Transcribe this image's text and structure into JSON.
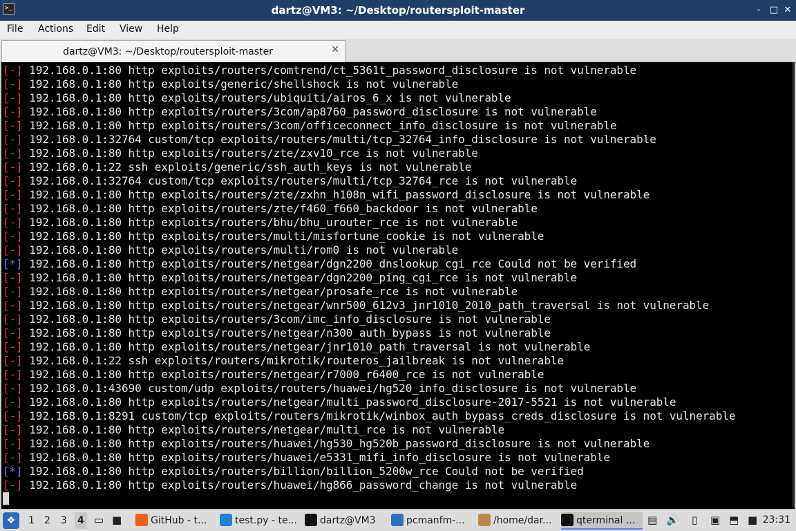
{
  "window": {
    "title": "dartz@VM3: ~/Desktop/routersploit-master",
    "app_icon": "terminal-icon",
    "controls": [
      "-",
      "□",
      "✕"
    ]
  },
  "menu": [
    "File",
    "Actions",
    "Edit",
    "View",
    "Help"
  ],
  "tab": {
    "label": "dartz@VM3: ~/Desktop/routersploit-master",
    "close": "✕"
  },
  "terminal": {
    "lines": [
      {
        "mark": "[-]",
        "text": " 192.168.0.1:80 http exploits/routers/comtrend/ct_5361t_password_disclosure is not vulnerable"
      },
      {
        "mark": "[-]",
        "text": " 192.168.0.1:80 http exploits/generic/shellshock is not vulnerable"
      },
      {
        "mark": "[-]",
        "text": " 192.168.0.1:80 http exploits/routers/ubiquiti/airos_6_x is not vulnerable"
      },
      {
        "mark": "[-]",
        "text": " 192.168.0.1:80 http exploits/routers/3com/ap8760_password_disclosure is not vulnerable"
      },
      {
        "mark": "[-]",
        "text": " 192.168.0.1:80 http exploits/routers/3com/officeconnect_info_disclosure is not vulnerable"
      },
      {
        "mark": "[-]",
        "text": " 192.168.0.1:32764 custom/tcp exploits/routers/multi/tcp_32764_info_disclosure is not vulnerable"
      },
      {
        "mark": "[-]",
        "text": " 192.168.0.1:80 http exploits/routers/zte/zxv10_rce is not vulnerable"
      },
      {
        "mark": "[-]",
        "text": " 192.168.0.1:22 ssh exploits/generic/ssh_auth_keys is not vulnerable"
      },
      {
        "mark": "[-]",
        "text": " 192.168.0.1:32764 custom/tcp exploits/routers/multi/tcp_32764_rce is not vulnerable"
      },
      {
        "mark": "[-]",
        "text": " 192.168.0.1:80 http exploits/routers/zte/zxhn_h108n_wifi_password_disclosure is not vulnerable"
      },
      {
        "mark": "[-]",
        "text": " 192.168.0.1:80 http exploits/routers/zte/f460_f660_backdoor is not vulnerable"
      },
      {
        "mark": "[-]",
        "text": " 192.168.0.1:80 http exploits/routers/bhu/bhu_urouter_rce is not vulnerable"
      },
      {
        "mark": "[-]",
        "text": " 192.168.0.1:80 http exploits/routers/multi/misfortune_cookie is not vulnerable"
      },
      {
        "mark": "[-]",
        "text": " 192.168.0.1:80 http exploits/routers/multi/rom0 is not vulnerable"
      },
      {
        "mark": "[*]",
        "text": " 192.168.0.1:80 http exploits/routers/netgear/dgn2200_dnslookup_cgi_rce Could not be verified"
      },
      {
        "mark": "[-]",
        "text": " 192.168.0.1:80 http exploits/routers/netgear/dgn2200_ping_cgi_rce is not vulnerable"
      },
      {
        "mark": "[-]",
        "text": " 192.168.0.1:80 http exploits/routers/netgear/prosafe_rce is not vulnerable"
      },
      {
        "mark": "[-]",
        "text": " 192.168.0.1:80 http exploits/routers/netgear/wnr500_612v3_jnr1010_2010_path_traversal is not vulnerable"
      },
      {
        "mark": "[-]",
        "text": " 192.168.0.1:80 http exploits/routers/3com/imc_info_disclosure is not vulnerable"
      },
      {
        "mark": "[-]",
        "text": " 192.168.0.1:80 http exploits/routers/netgear/n300_auth_bypass is not vulnerable"
      },
      {
        "mark": "[-]",
        "text": " 192.168.0.1:80 http exploits/routers/netgear/jnr1010_path_traversal is not vulnerable"
      },
      {
        "mark": "[-]",
        "text": " 192.168.0.1:22 ssh exploits/routers/mikrotik/routeros_jailbreak is not vulnerable"
      },
      {
        "mark": "[-]",
        "text": " 192.168.0.1:80 http exploits/routers/netgear/r7000_r6400_rce is not vulnerable"
      },
      {
        "mark": "[-]",
        "text": " 192.168.0.1:43690 custom/udp exploits/routers/huawei/hg520_info_disclosure is not vulnerable"
      },
      {
        "mark": "[-]",
        "text": " 192.168.0.1:80 http exploits/routers/netgear/multi_password_disclosure-2017-5521 is not vulnerable"
      },
      {
        "mark": "[-]",
        "text": " 192.168.0.1:8291 custom/tcp exploits/routers/mikrotik/winbox_auth_bypass_creds_disclosure is not vulnerable"
      },
      {
        "mark": "[-]",
        "text": " 192.168.0.1:80 http exploits/routers/netgear/multi_rce is not vulnerable"
      },
      {
        "mark": "[-]",
        "text": " 192.168.0.1:80 http exploits/routers/huawei/hg530_hg520b_password_disclosure is not vulnerable"
      },
      {
        "mark": "[-]",
        "text": " 192.168.0.1:80 http exploits/routers/huawei/e5331_mifi_info_disclosure is not vulnerable"
      },
      {
        "mark": "[*]",
        "text": " 192.168.0.1:80 http exploits/routers/billion/billion_5200w_rce Could not be verified"
      },
      {
        "mark": "[-]",
        "text": " 192.168.0.1:80 http exploits/routers/huawei/hg866_password_change is not vulnerable"
      }
    ]
  },
  "taskbar": {
    "workspaces": [
      "1",
      "2",
      "3",
      "4"
    ],
    "active_workspace": "4",
    "items": [
      {
        "label": "GitHub - t...",
        "icon": "firefox-icon",
        "color": "#e8641c"
      },
      {
        "label": "test.py - te...",
        "icon": "vscode-icon",
        "color": "#1f7fd1"
      },
      {
        "label": "dartz@VM3",
        "icon": "terminal-icon",
        "color": "#111111"
      },
      {
        "label": "pcmanfm-...",
        "icon": "folder-icon",
        "color": "#2f6fb8"
      },
      {
        "label": "/home/dar...",
        "icon": "archive-icon",
        "color": "#b88a4a"
      },
      {
        "label": "qterminal ...",
        "icon": "terminal-icon",
        "color": "#111111"
      }
    ],
    "clock": "23:31"
  }
}
